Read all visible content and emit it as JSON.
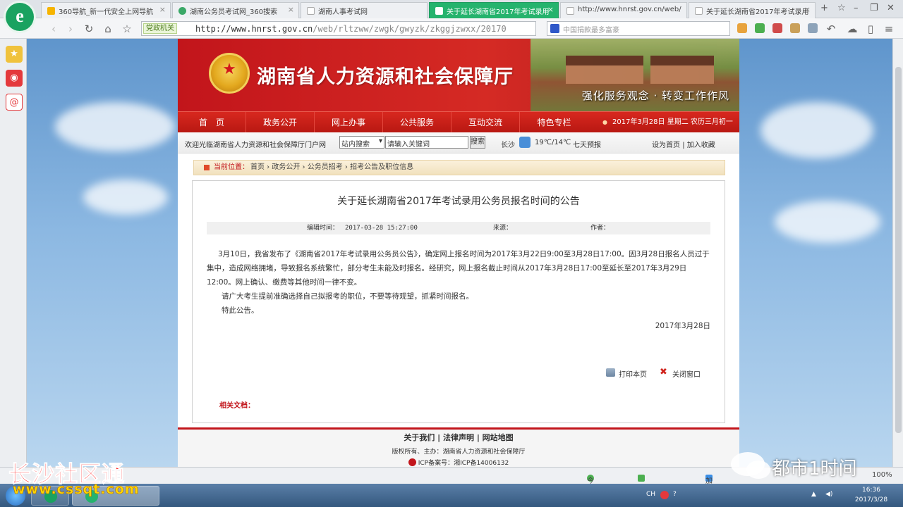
{
  "browser": {
    "tabs": [
      {
        "label": "360导航_新一代安全上网导航"
      },
      {
        "label": "湖南公务员考试网_360搜索"
      },
      {
        "label": "湖南人事考试网"
      },
      {
        "label": "关于延长湖南省2017年考试录用"
      },
      {
        "label": "http://www.hnrst.gov.cn/web/"
      },
      {
        "label": "关于延长湖南省2017年考试录用"
      }
    ],
    "cert_label": "党政机关",
    "url_host": "http://www.hnrst.gov.cn",
    "url_path": "/web/rltzww/zwgk/gwyzk/zkggjzwxx/201703/t2017",
    "search_placeholder": "中国捐款最多富豪"
  },
  "site": {
    "title": "湖南省人力资源和社会保障厅",
    "slogan": "强化服务观念 · 转变工作作风",
    "nav": [
      "首　页",
      "政务公开",
      "网上办事",
      "公共服务",
      "互动交流",
      "特色专栏"
    ],
    "date_line": "2017年3月28日 星期二 农历三月初一",
    "welcome": "欢迎光临湖南省人力资源和社会保障厅门户网",
    "search_scope": "站内搜索",
    "search_value": "请输入关键词",
    "search_button": "搜索",
    "city": "长沙",
    "temperature": "19℃/14℃",
    "forecast_link": "七天预报",
    "set_home": "设为首页",
    "add_favorite": "加入收藏"
  },
  "breadcrumb": {
    "label": "当前位置：",
    "path": "首页 › 政务公开 › 公务员招考 › 招考公告及职位信息"
  },
  "article": {
    "title": "关于延长湖南省2017年考试录用公务员报名时间的公告",
    "edit_time_label": "编辑时间：",
    "edit_time": "2017-03-28 15:27:00",
    "source_label": "来源：",
    "author_label": "作者：",
    "paragraphs": [
      "3月10日，我省发布了《湖南省2017年考试录用公务员公告》，确定网上报名时间为2017年3月22日9:00至3月28日17:00。因3月28日报名人员过于集中，造成网络拥堵，导致报名系统繁忙，部分考生未能及时报名。经研究，网上报名截止时间从2017年3月28日17:00至延长至2017年3月29日12:00。网上确认、缴费等其他时间一律不变。",
      "请广大考生提前准确选择自己拟报考的职位，不要等待观望，抓紧时间报名。",
      "特此公告。"
    ],
    "date": "2017年3月28日",
    "print_label": "打印本页",
    "close_label": "关闭窗口",
    "related_label": "相关文档："
  },
  "footer": {
    "links": "关于我们 | 法律声明 | 网站地图",
    "copyright": "版权所有、主办：湖南省人力资源和社会保障厅",
    "icp": "ICP备案号：湘ICP备14006132"
  },
  "statusbar": {
    "live": "今日直播",
    "speed": "加速器",
    "zoom": "100%"
  },
  "taskbar": {
    "lang": "CH",
    "time": "16:36",
    "date": "2017/3/28"
  },
  "watermarks": {
    "left_title": "长沙社区通",
    "left_url": "www.cssqt.com",
    "right_text": "都市1时间"
  },
  "colors": {
    "brand_red": "#c2151b",
    "active_tab": "#25b36d"
  }
}
